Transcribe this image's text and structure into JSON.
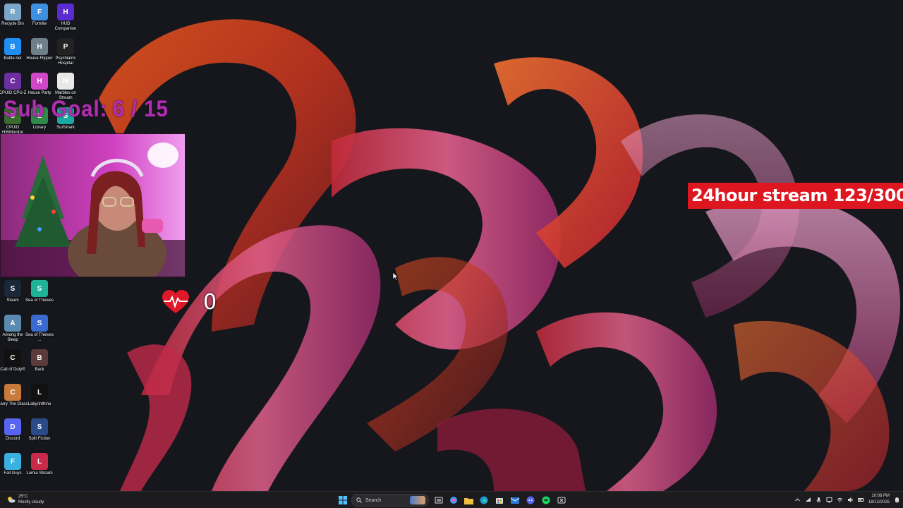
{
  "desktop_icons": [
    {
      "label": "Recycle Bin",
      "icon": "recycle-bin-icon",
      "color": "#7aa6c8"
    },
    {
      "label": "Fortnite",
      "icon": "fortnite-icon",
      "color": "#3d8fe0"
    },
    {
      "label": "HUD Companion",
      "icon": "hud-fx-icon",
      "color": "#5a2bd0"
    },
    {
      "label": "Battle.net",
      "icon": "battlenet-icon",
      "color": "#1f8ef0"
    },
    {
      "label": "House Flipper",
      "icon": "house-flipper-icon",
      "color": "#6f7f8a"
    },
    {
      "label": "Psychiatric Hospital",
      "icon": "psychiatric-hospital-icon",
      "color": "#222222"
    },
    {
      "label": "CPUID CPU-Z",
      "icon": "cpu-z-icon",
      "color": "#6b2fa0"
    },
    {
      "label": "House Party",
      "icon": "house-party-icon",
      "color": "#d048c8"
    },
    {
      "label": "Marbles on Stream",
      "icon": "marbles-icon",
      "color": "#e8e8e8"
    },
    {
      "label": "CPUID HWMonitor",
      "icon": "hwmonitor-icon",
      "color": "#3a6a30"
    },
    {
      "label": "Library",
      "icon": "library-icon",
      "color": "#2f8a4a"
    },
    {
      "label": "Surfshark",
      "icon": "surfshark-icon",
      "color": "#1aa8a0"
    },
    {
      "label": "Steam",
      "icon": "steam-icon",
      "color": "#1b2838"
    },
    {
      "label": "Sea of Thieves",
      "icon": "sea-of-thieves-icon",
      "color": "#1fb39a"
    },
    {
      "label": "Among the Sleep",
      "icon": "among-the-sleep-icon",
      "color": "#5a8ab0"
    },
    {
      "label": "Sea of Thieves ...",
      "icon": "music-note-icon",
      "color": "#3a6ad0"
    },
    {
      "label": "Call of Duty®",
      "icon": "call-of-duty-icon",
      "color": "#111111"
    },
    {
      "label": "Back",
      "icon": "back-icon",
      "color": "#5a3a3a"
    },
    {
      "label": "Carry The Glass",
      "icon": "carry-the-glass-icon",
      "color": "#c87a3a"
    },
    {
      "label": "Labyrinthine",
      "icon": "labyrinthine-icon",
      "color": "#111111"
    },
    {
      "label": "Discord",
      "icon": "discord-icon",
      "color": "#5865f2"
    },
    {
      "label": "Split Fiction",
      "icon": "split-fiction-icon",
      "color": "#2a4a8a"
    },
    {
      "label": "Fall Guys",
      "icon": "fall-guys-icon",
      "color": "#3ab0e0"
    },
    {
      "label": "Lumia Stream",
      "icon": "lumia-stream-icon",
      "color": "#c82a4a"
    }
  ],
  "overlays": {
    "sub_goal_label": "Sub Goal:",
    "sub_goal_value": "6 / 15",
    "stream_banner": "24hour stream 123/300",
    "heart_rate": "0"
  },
  "taskbar": {
    "weather_temp": "25°C",
    "weather_desc": "Mostly cloudy",
    "search_placeholder": "Search",
    "time": "10:08 PM",
    "date": "18/12/2025"
  },
  "colors": {
    "sub_goal": "#b02fb0",
    "banner_bg": "#dd1620",
    "taskbar_bg": "#1c1c1f"
  }
}
